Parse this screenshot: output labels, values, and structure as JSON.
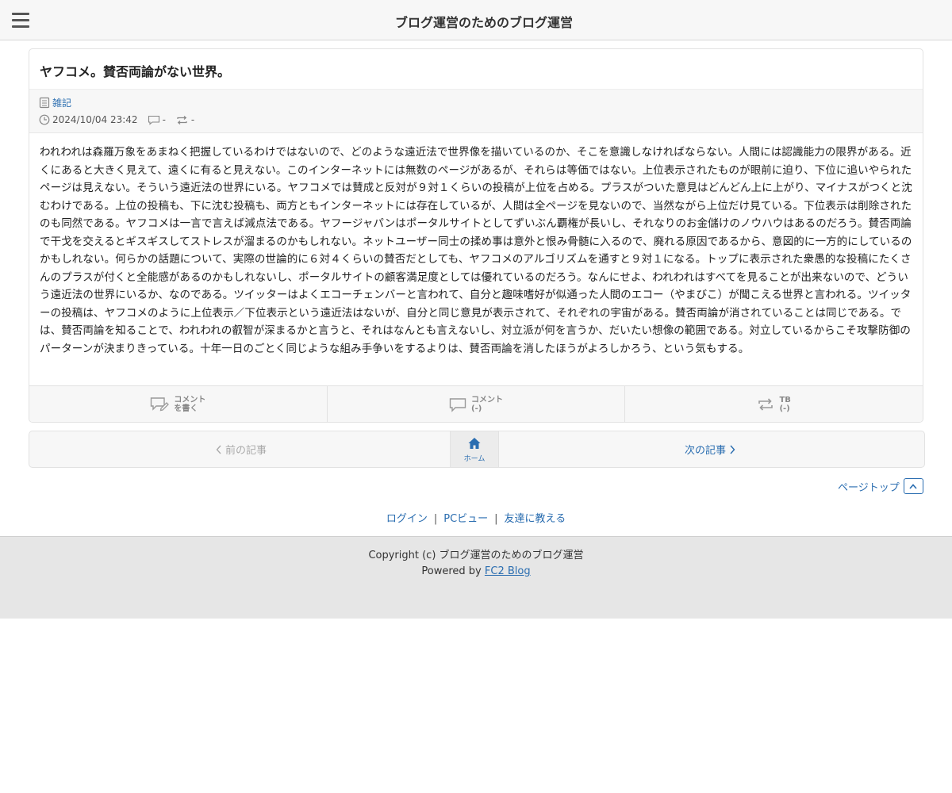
{
  "header": {
    "site_title": "ブログ運営のためのブログ運営"
  },
  "entry": {
    "title": "ヤフコメ。賛否両論がない世界。",
    "category": "雑記",
    "datetime": "2024/10/04 23:42",
    "comment_count": "-",
    "trackback_count": "-",
    "body": "われわれは森羅万象をあまねく把握しているわけではないので、どのような遠近法で世界像を描いているのか、そこを意識しなければならない。人間には認識能力の限界がある。近くにあると大きく見えて、遠くに有ると見えない。このインターネットには無数のページがあるが、それらは等価ではない。上位表示されたものが眼前に迫り、下位に追いやられたページは見えない。そういう遠近法の世界にいる。ヤフコメでは賛成と反対が９対１くらいの投稿が上位を占める。プラスがついた意見はどんどん上に上がり、マイナスがつくと沈むわけである。上位の投稿も、下に沈む投稿も、両方ともインターネットには存在しているが、人間は全ページを見ないので、当然ながら上位だけ見ている。下位表示は削除されたのも同然である。ヤフコメは一言で言えば減点法である。ヤフージャパンはポータルサイトとしてずいぶん覇権が長いし、それなりのお金儲けのノウハウはあるのだろう。賛否両論で干戈を交えるとギスギスしてストレスが溜まるのかもしれない。ネットユーザー同士の揉め事は意外と恨み骨髄に入るので、廃れる原因であるから、意図的に一方的にしているのかもしれない。何らかの話題について、実際の世論的に６対４くらいの賛否だとしても、ヤフコメのアルゴリズムを通すと９対１になる。トップに表示された衆愚的な投稿にたくさんのプラスが付くと全能感があるのかもしれないし、ポータルサイトの顧客満足度としては優れているのだろう。なんにせよ、われわれはすべてを見ることが出来ないので、どういう遠近法の世界にいるか、なのである。ツイッターはよくエコーチェンバーと言われて、自分と趣味嗜好が似通った人間のエコー（やまびこ）が聞こえる世界と言われる。ツイッターの投稿は、ヤフコメのように上位表示／下位表示という遠近法はないが、自分と同じ意見が表示されて、それぞれの宇宙がある。賛否両論が消されていることは同じである。では、賛否両論を知ることで、われわれの叡智が深まるかと言うと、それはなんとも言えないし、対立派が何を言うか、だいたい想像の範囲である。対立しているからこそ攻撃防御のパーターンが決まりきっている。十年一日のごとく同じような組み手争いをするよりは、賛否両論を消したほうがよろしかろう、という気もする。"
  },
  "actions": {
    "write_comment": {
      "line1": "コメント",
      "line2": "を書く"
    },
    "comments": {
      "line1": "コメント",
      "line2": "(-)"
    },
    "trackback": {
      "line1": "TB",
      "line2": "(-)"
    }
  },
  "pager": {
    "prev": "前の記事",
    "home": "ホーム",
    "next": "次の記事"
  },
  "pagetop": "ページトップ",
  "footer_links": {
    "login": "ログイン",
    "pc_view": "PCビュー",
    "tell_friend": "友達に教える",
    "separator": "|"
  },
  "footer": {
    "copyright": "Copyright (c) ブログ運営のためのブログ運営",
    "powered_prefix": "Powered by",
    "powered_link": "FC2 Blog"
  },
  "colors": {
    "link": "#2a6db0",
    "footer_bg": "#e6e6e6",
    "bar_bg": "#f7f7f7"
  }
}
